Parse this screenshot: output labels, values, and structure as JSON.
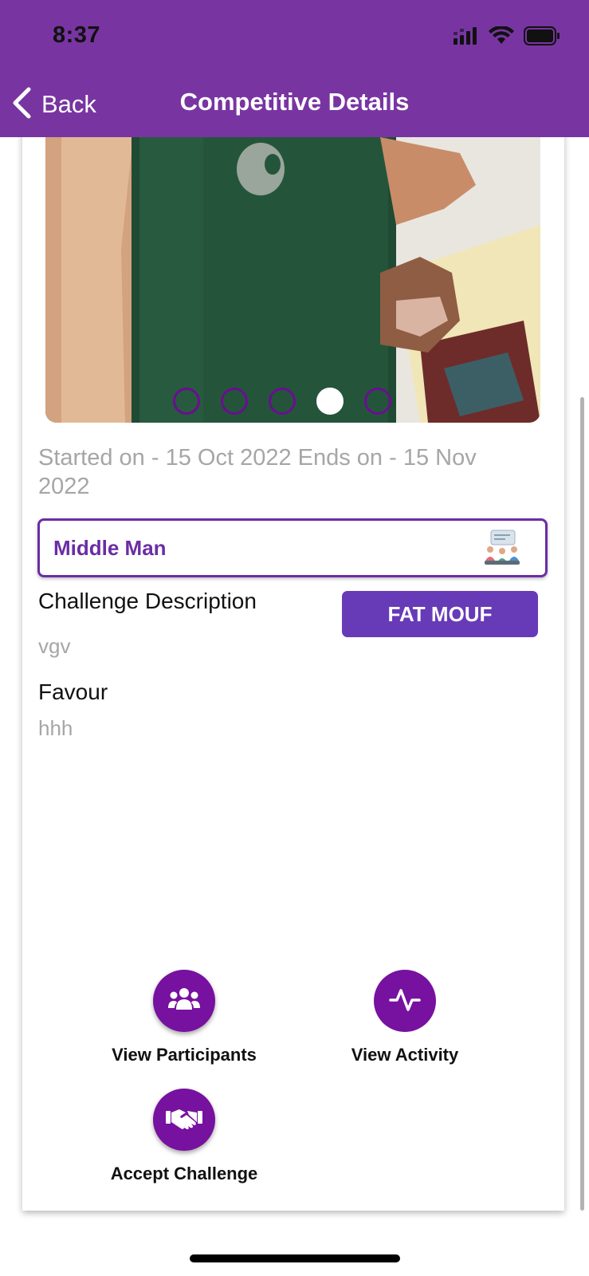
{
  "status_bar": {
    "time": "8:37",
    "icons": [
      "signal-icon",
      "wifi-icon",
      "battery-icon"
    ]
  },
  "nav": {
    "back_label": "Back",
    "title": "Competitive Details"
  },
  "carousel": {
    "slide_count": 5,
    "active_index": 3,
    "image_description_icon": "photo-of-hand-holding-green-phone"
  },
  "challenge": {
    "dates_text": "Started on - 15 Oct 2022 Ends on - 15 Nov 2022",
    "category": "Middle Man",
    "description_title": "Challenge Description",
    "description_value": "vgv",
    "tag_button": "FAT MOUF",
    "favour_title": "Favour",
    "favour_value": "hhh"
  },
  "actions": {
    "view_participants": "View Participants",
    "view_activity": "View Activity",
    "accept_challenge": "Accept Challenge"
  },
  "colors": {
    "header_bg": "#7835a1",
    "accent": "#6b2da5",
    "button": "#673ab7",
    "action_circle": "#77119f",
    "muted_text": "#a6a6a6"
  }
}
